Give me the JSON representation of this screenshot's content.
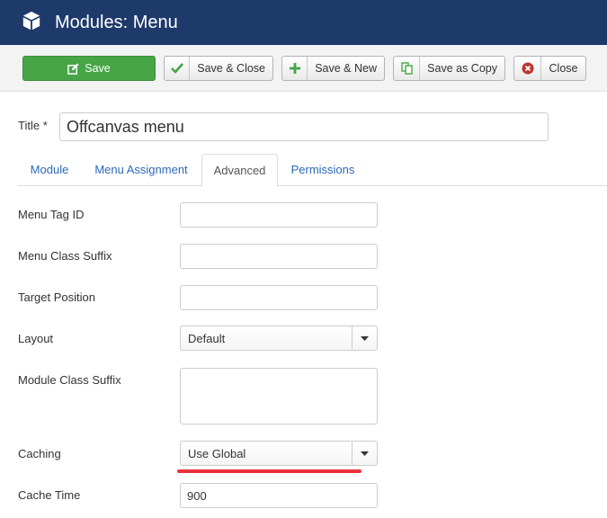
{
  "header": {
    "title": "Modules: Menu",
    "icon": "cube-icon"
  },
  "toolbar": {
    "save": "Save",
    "save_close": "Save & Close",
    "save_new": "Save & New",
    "save_copy": "Save as Copy",
    "close": "Close"
  },
  "title_field": {
    "label": "Title *",
    "value": "Offcanvas menu"
  },
  "tabs": [
    "Module",
    "Menu Assignment",
    "Advanced",
    "Permissions"
  ],
  "active_tab": "Advanced",
  "fields": {
    "menu_tag_id": {
      "label": "Menu Tag ID",
      "value": ""
    },
    "menu_class_suffix": {
      "label": "Menu Class Suffix",
      "value": ""
    },
    "target_position": {
      "label": "Target Position",
      "value": ""
    },
    "layout": {
      "label": "Layout",
      "value": "Default"
    },
    "module_class_suffix": {
      "label": "Module Class Suffix",
      "value": ""
    },
    "caching": {
      "label": "Caching",
      "value": "Use Global"
    },
    "cache_time": {
      "label": "Cache Time",
      "value": "900"
    }
  },
  "colors": {
    "header_bg": "#1e3a6b",
    "save_green": "#46a546",
    "link_blue": "#2a69b8",
    "highlight_red": "#e8333d"
  }
}
